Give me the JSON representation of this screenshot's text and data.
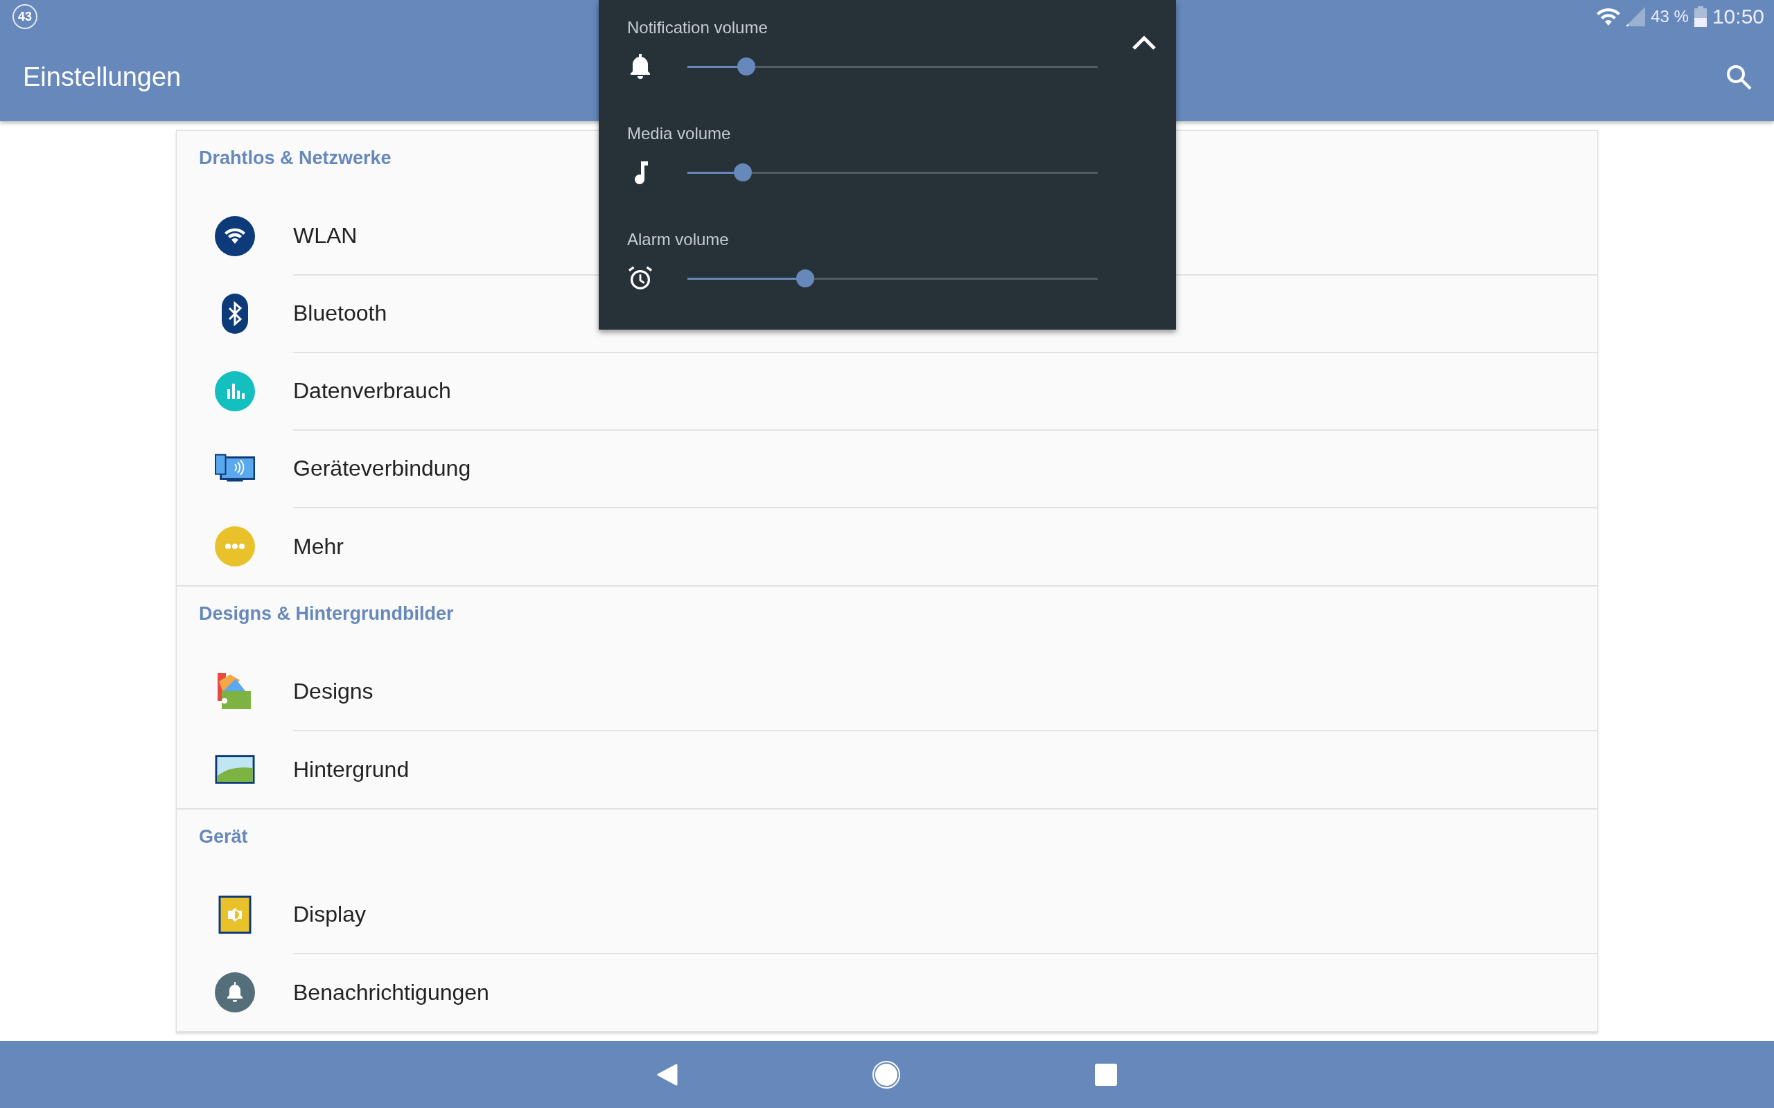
{
  "status_bar": {
    "notification_count": "43",
    "battery_percent": "43 %",
    "time": "10:50"
  },
  "app_bar": {
    "title": "Einstellungen"
  },
  "sections": [
    {
      "title": "Drahtlos & Netzwerke",
      "items": [
        {
          "label": "WLAN"
        },
        {
          "label": "Bluetooth"
        },
        {
          "label": "Datenverbrauch"
        },
        {
          "label": "Geräteverbindung"
        },
        {
          "label": "Mehr"
        }
      ]
    },
    {
      "title": "Designs & Hintergrundbilder",
      "items": [
        {
          "label": "Designs"
        },
        {
          "label": "Hintergrund"
        }
      ]
    },
    {
      "title": "Gerät",
      "items": [
        {
          "label": "Display"
        },
        {
          "label": "Benachrichtigungen"
        }
      ]
    }
  ],
  "volume_panel": {
    "sliders": [
      {
        "label": "Notification volume",
        "level": 0.143
      },
      {
        "label": "Media volume",
        "level": 0.135
      },
      {
        "label": "Alarm volume",
        "level": 0.287
      }
    ]
  }
}
